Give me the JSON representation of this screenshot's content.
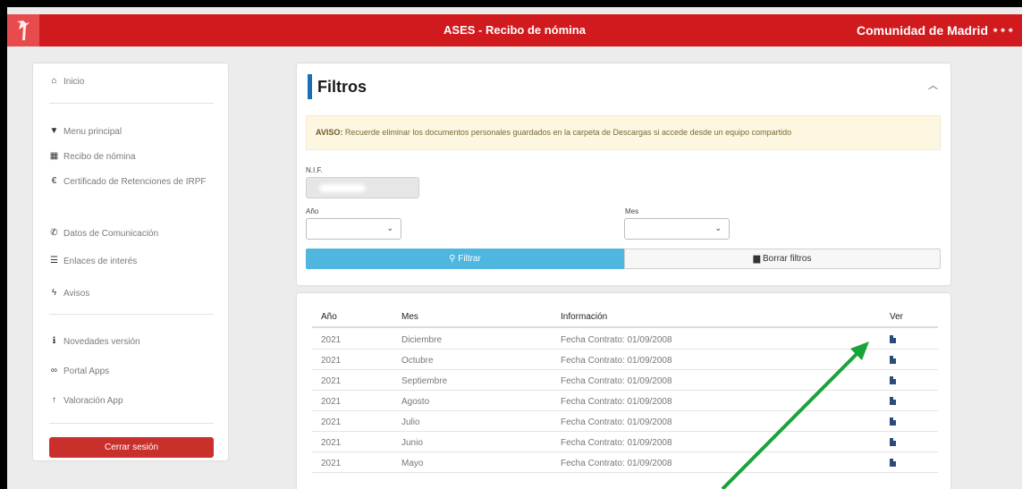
{
  "header": {
    "app_title": "ASES - Recibo de nómina",
    "brand": "Comunidad de Madrid",
    "brand_mark": "⁕⁕⁕"
  },
  "sidebar": {
    "items": [
      {
        "label": "Inicio",
        "icon": "home-icon",
        "glyph": "⌂"
      },
      {
        "label": "Menu principal",
        "icon": "filter-icon",
        "glyph": "▼"
      },
      {
        "label": "Recibo de nómina",
        "icon": "calendar-icon",
        "glyph": "▦"
      },
      {
        "label": "Certificado de Retenciones de IRPF",
        "icon": "euro-icon",
        "glyph": "€"
      },
      {
        "label": "Datos de Comunicación",
        "icon": "phone-icon",
        "glyph": "✆"
      },
      {
        "label": "Enlaces de interés",
        "icon": "list-icon",
        "glyph": "☰"
      },
      {
        "label": "Avisos",
        "icon": "bolt-icon",
        "glyph": "ϟ"
      },
      {
        "label": "Novedades versión",
        "icon": "info-icon",
        "glyph": "ℹ"
      },
      {
        "label": "Portal Apps",
        "icon": "link-icon",
        "glyph": "∞"
      },
      {
        "label": "Valoración App",
        "icon": "thumbs-up-icon",
        "glyph": "↑"
      }
    ],
    "logout_label": "Cerrar sesión"
  },
  "filters": {
    "title": "Filtros",
    "notice_bold": "AVISO:",
    "notice_text": " Recuerde eliminar los documentos personales guardados en la carpeta de Descargas si accede desde un equipo compartido",
    "nif_label": "N.I.F.",
    "year_label": "Año",
    "month_label": "Mes",
    "filter_button": "Filtrar",
    "clear_button": "Borrar filtros"
  },
  "table": {
    "headers": [
      "Año",
      "Mes",
      "Información",
      "Ver"
    ],
    "rows": [
      {
        "year": "2021",
        "month": "Diciembre",
        "info": "Fecha Contrato: 01/09/2008"
      },
      {
        "year": "2021",
        "month": "Octubre",
        "info": "Fecha Contrato: 01/09/2008"
      },
      {
        "year": "2021",
        "month": "Septiembre",
        "info": "Fecha Contrato: 01/09/2008"
      },
      {
        "year": "2021",
        "month": "Agosto",
        "info": "Fecha Contrato: 01/09/2008"
      },
      {
        "year": "2021",
        "month": "Julio",
        "info": "Fecha Contrato: 01/09/2008"
      },
      {
        "year": "2021",
        "month": "Junio",
        "info": "Fecha Contrato: 01/09/2008"
      },
      {
        "year": "2021",
        "month": "Mayo",
        "info": "Fecha Contrato: 01/09/2008"
      }
    ]
  },
  "colors": {
    "header_red": "#d11a1d",
    "accent_blue": "#1a6fb5",
    "filter_button": "#4fb6e0",
    "logout_red": "#c9302c",
    "annotation_arrow": "#1aa33a"
  }
}
